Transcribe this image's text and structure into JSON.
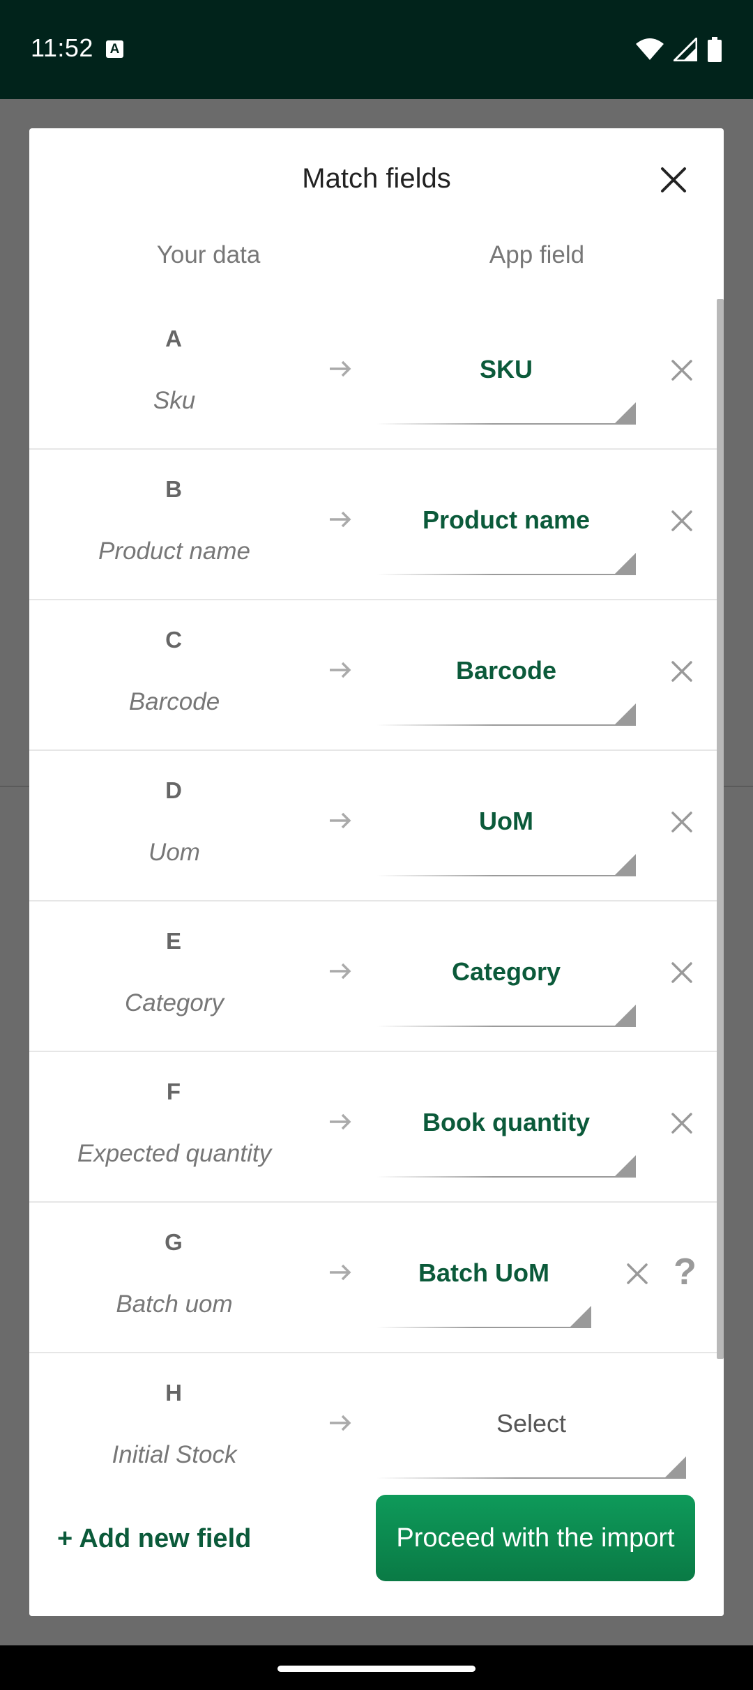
{
  "status_bar": {
    "time": "11:52",
    "notification_icon": "a-box-icon",
    "icons": [
      "wifi-icon",
      "signal-icon",
      "battery-icon"
    ]
  },
  "dialog": {
    "title": "Match fields",
    "close_icon": "close-icon",
    "headers": {
      "your_data": "Your data",
      "app_field": "App field"
    },
    "rows": [
      {
        "letter": "A",
        "source": "Sku",
        "field": "SKU"
      },
      {
        "letter": "B",
        "source": "Product name",
        "field": "Product name"
      },
      {
        "letter": "C",
        "source": "Barcode",
        "field": "Barcode"
      },
      {
        "letter": "D",
        "source": "Uom",
        "field": "UoM"
      },
      {
        "letter": "E",
        "source": "Category",
        "field": "Category"
      },
      {
        "letter": "F",
        "source": "Expected quantity",
        "field": "Book quantity"
      },
      {
        "letter": "G",
        "source": "Batch uom",
        "field": "Batch UoM",
        "help": "?"
      },
      {
        "letter": "H",
        "source": "Initial Stock",
        "field": "Select"
      }
    ],
    "footer": {
      "add_field": "+ Add new field",
      "proceed": "Proceed with the import"
    }
  },
  "colors": {
    "status_bar": "#01231b",
    "accent": "#0b5a3a",
    "button": "#0a8a50"
  }
}
